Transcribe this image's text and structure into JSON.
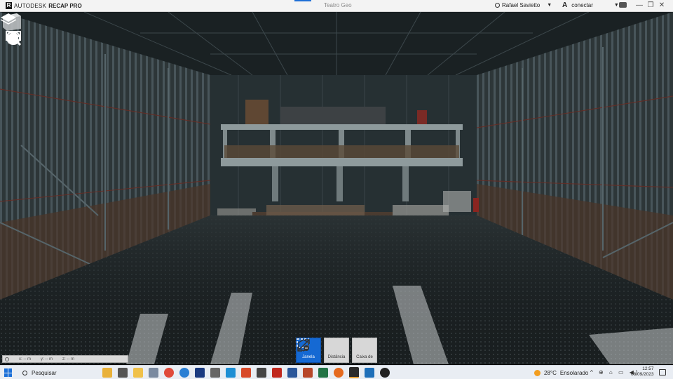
{
  "titlebar": {
    "brand_main": "AUTODESK",
    "brand_product": "RECAP PRO",
    "document_title": "Teatro Geo",
    "user_name": "Rafael Savietto",
    "connect_label": "conectar",
    "icons": [
      "user-icon",
      "autodesk-a-icon",
      "chat-icon",
      "minimize-icon",
      "restore-icon",
      "close-icon"
    ]
  },
  "left_toolbar": [
    {
      "name": "home-icon"
    },
    {
      "name": "display-settings-icon"
    },
    {
      "name": "navigation-icon"
    },
    {
      "name": "search-icon"
    }
  ],
  "coordinates": {
    "x_label": "x: -- m",
    "y_label": "y: -- m",
    "z_label": "z: -- m"
  },
  "bottom_tools": [
    {
      "label": "Janela",
      "icon": "window-select-icon",
      "active": true
    },
    {
      "label": "Distância",
      "icon": "distance-icon",
      "active": false
    },
    {
      "label": "Caixa de",
      "icon": "limit-box-icon",
      "active": false
    }
  ],
  "taskbar": {
    "search_placeholder": "Pesquisar",
    "weather_temp": "28°C",
    "weather_text": "Ensolarado",
    "time": "12:57",
    "date": "08/09/2023",
    "tray_icons": "^ ⊕ ⌂ ▭ ◀)"
  },
  "colors": {
    "accent": "#1569d3",
    "weather_sun": "#f29d1f"
  }
}
